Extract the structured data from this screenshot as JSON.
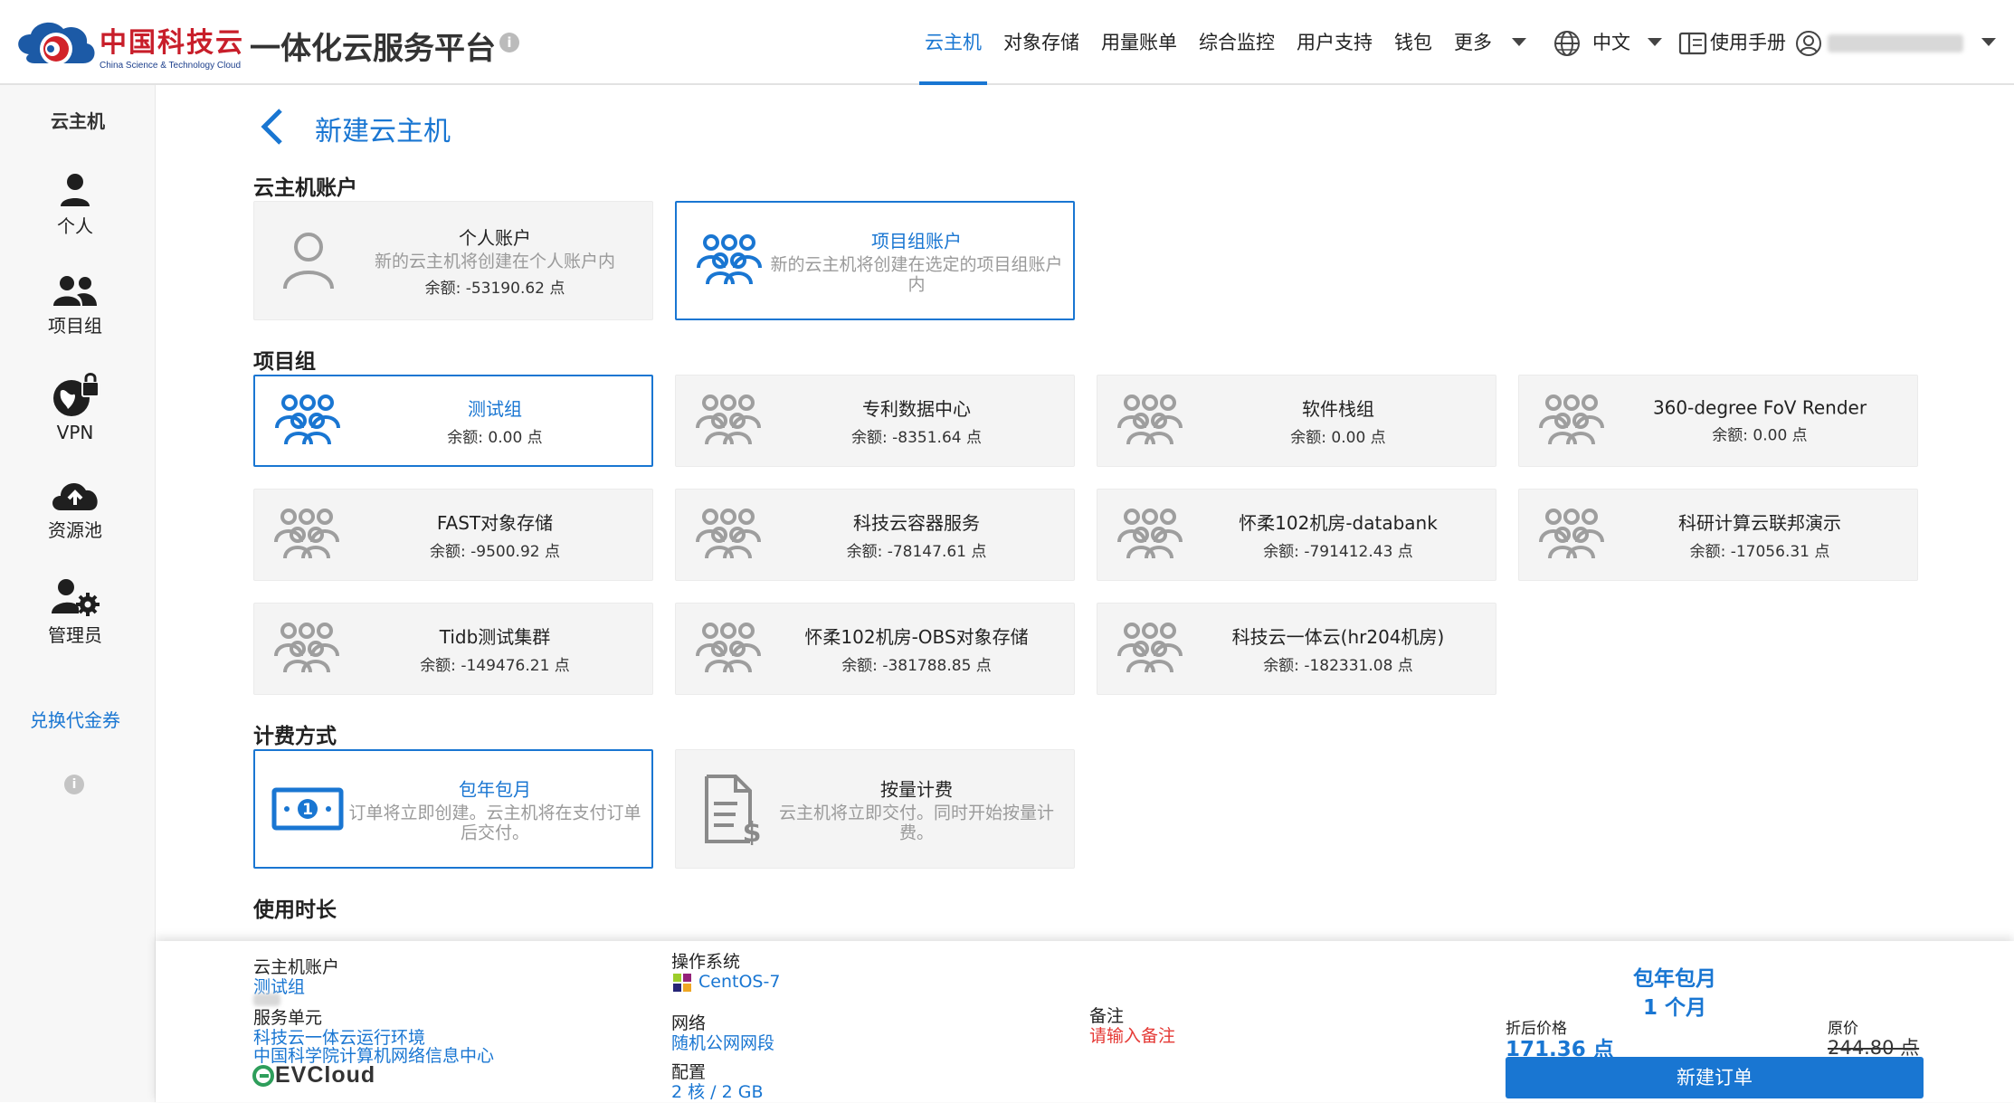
{
  "header": {
    "brand_cn": "中国科技云",
    "brand_en": "China Science & Technology Cloud",
    "platform_title": "一体化云服务平台",
    "info_glyph": "i",
    "nav": [
      {
        "label": "云主机",
        "active": true
      },
      {
        "label": "对象存储"
      },
      {
        "label": "用量账单"
      },
      {
        "label": "综合监控"
      },
      {
        "label": "用户支持"
      },
      {
        "label": "钱包"
      },
      {
        "label": "更多"
      }
    ],
    "language": "中文",
    "manual": "使用手册"
  },
  "sidebar": {
    "title": "云主机",
    "items": [
      {
        "label": "个人",
        "icon": "person-icon"
      },
      {
        "label": "项目组",
        "icon": "group-icon"
      },
      {
        "label": "VPN",
        "icon": "vpn-globe-lock-icon"
      },
      {
        "label": "资源池",
        "icon": "cloud-upload-icon"
      },
      {
        "label": "管理员",
        "icon": "admin-gear-icon"
      }
    ],
    "voucher_link": "兑换代金券",
    "info_glyph": "i"
  },
  "page": {
    "title": "新建云主机",
    "sections": {
      "account": "云主机账户",
      "project_group": "项目组",
      "billing": "计费方式",
      "duration": "使用时长"
    }
  },
  "accounts": [
    {
      "name": "个人账户",
      "desc": "新的云主机将创建在个人账户内",
      "balance": "余额: -53190.62 点",
      "selected": false
    },
    {
      "name": "项目组账户",
      "desc": "新的云主机将创建在选定的项目组账户内",
      "selected": true
    }
  ],
  "groups": [
    {
      "name": "测试组",
      "balance": "余额: 0.00 点",
      "selected": true
    },
    {
      "name": "专利数据中心",
      "balance": "余额: -8351.64 点"
    },
    {
      "name": "软件栈组",
      "balance": "余额: 0.00 点"
    },
    {
      "name": "360-degree FoV Render",
      "balance": "余额: 0.00 点"
    },
    {
      "name": "FAST对象存储",
      "balance": "余额: -9500.92 点"
    },
    {
      "name": "科技云容器服务",
      "balance": "余额: -78147.61 点"
    },
    {
      "name": "怀柔102机房-databank",
      "balance": "余额: -791412.43 点"
    },
    {
      "name": "科研计算云联邦演示",
      "balance": "余额: -17056.31 点"
    },
    {
      "name": "Tidb测试集群",
      "balance": "余额: -149476.21 点"
    },
    {
      "name": "怀柔102机房-OBS对象存储",
      "balance": "余额: -381788.85 点"
    },
    {
      "name": "科技云一体云(hr204机房)",
      "balance": "余额: -182331.08 点"
    }
  ],
  "billing": [
    {
      "name": "包年包月",
      "desc": "订单将立即创建。云主机将在支付订单后交付。",
      "selected": true
    },
    {
      "name": "按量计费",
      "desc": "云主机将立即交付。同时开始按量计费。",
      "selected": false
    }
  ],
  "summary": {
    "account_label": "云主机账户",
    "account_value": "测试组",
    "unit_label": "服务单元",
    "unit_value_1": "科技云一体云运行环境",
    "unit_value_2": "中国科学院计算机网络信息中心",
    "evcloud_logo": "EVCloud",
    "os_label": "操作系统",
    "os_value": "CentOS-7",
    "network_label": "网络",
    "network_value": "随机公网网段",
    "config_label": "配置",
    "config_value": "2 核 / 2 GB",
    "remark_label": "备注",
    "remark_placeholder": "请输入备注",
    "pay_type": "包年包月",
    "pay_duration": "1 个月",
    "discount_label": "折后价格",
    "discount_price": "171.36 点",
    "original_label": "原价",
    "original_price": "244.80 点",
    "order_button": "新建订单"
  },
  "colors": {
    "accent": "#1976d2",
    "brand_red": "#c81e2a",
    "warn": "#e53935"
  }
}
